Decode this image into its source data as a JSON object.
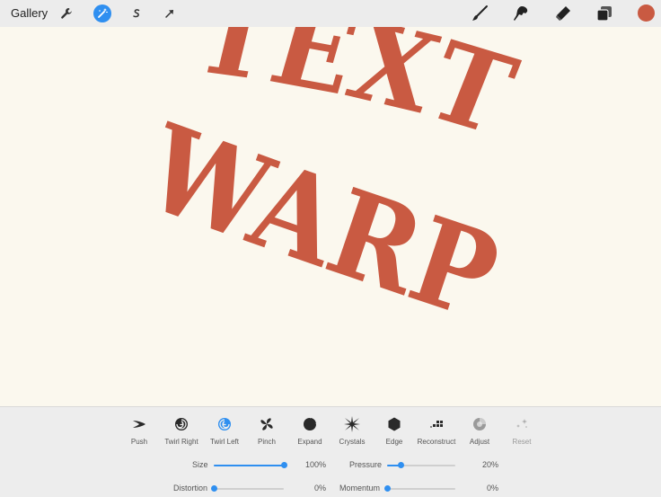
{
  "topbar": {
    "gallery_label": "Gallery",
    "left_icons": [
      "wrench-icon",
      "magic-wand-icon",
      "selection-icon",
      "transform-arrow-icon"
    ],
    "right_icons": [
      "brush-icon",
      "smudge-icon",
      "eraser-icon",
      "layers-icon"
    ],
    "active_color": "#c95a42",
    "accent_color": "#2f8ff0"
  },
  "canvas": {
    "line1": "TEXT",
    "line2": "WARP",
    "text_color": "#c95a42",
    "background": "#fbf8ee"
  },
  "liquify": {
    "tools": [
      {
        "label": "Push",
        "icon": "push-icon"
      },
      {
        "label": "Twirl Right",
        "icon": "twirl-right-icon"
      },
      {
        "label": "Twirl Left",
        "icon": "twirl-left-icon"
      },
      {
        "label": "Pinch",
        "icon": "pinch-icon"
      },
      {
        "label": "Expand",
        "icon": "expand-icon"
      },
      {
        "label": "Crystals",
        "icon": "crystals-icon"
      },
      {
        "label": "Edge",
        "icon": "edge-icon"
      },
      {
        "label": "Reconstruct",
        "icon": "reconstruct-icon"
      },
      {
        "label": "Adjust",
        "icon": "adjust-icon"
      },
      {
        "label": "Reset",
        "icon": "reset-icon"
      }
    ],
    "sliders": {
      "size": {
        "label": "Size",
        "value": "100%",
        "fraction": 1.0
      },
      "pressure": {
        "label": "Pressure",
        "value": "20%",
        "fraction": 0.2
      },
      "distortion": {
        "label": "Distortion",
        "value": "0%",
        "fraction": 0.0
      },
      "momentum": {
        "label": "Momentum",
        "value": "0%",
        "fraction": 0.0
      }
    }
  }
}
